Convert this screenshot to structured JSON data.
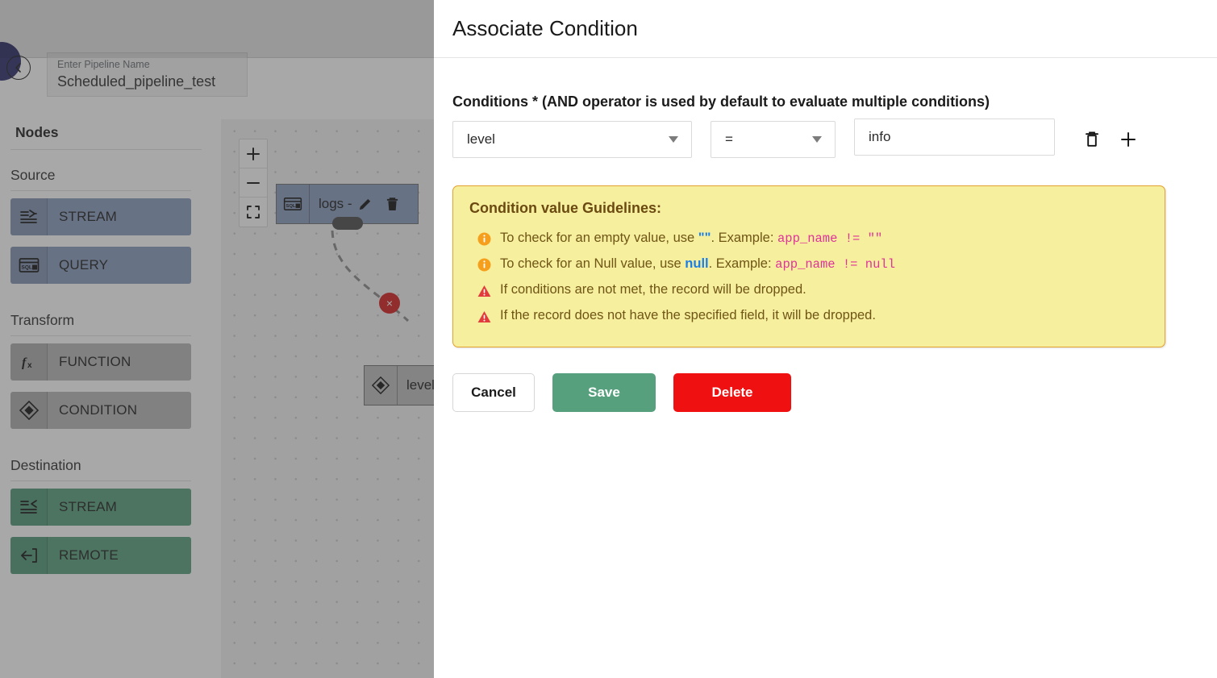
{
  "app": {
    "pipeline": {
      "name_label": "Enter Pipeline Name",
      "name_value": "Scheduled_pipeline_test"
    },
    "sidebar": {
      "title": "Nodes",
      "sections": [
        {
          "label": "Source",
          "items": [
            {
              "label": "STREAM",
              "icon": "stream-in-icon",
              "color": "blue"
            },
            {
              "label": "QUERY",
              "icon": "sql-query-icon",
              "color": "blue"
            }
          ]
        },
        {
          "label": "Transform",
          "items": [
            {
              "label": "FUNCTION",
              "icon": "fx-icon",
              "color": "gray"
            },
            {
              "label": "CONDITION",
              "icon": "diamond-icon",
              "color": "gray"
            }
          ]
        },
        {
          "label": "Destination",
          "items": [
            {
              "label": "STREAM",
              "icon": "stream-out-icon",
              "color": "green"
            },
            {
              "label": "REMOTE",
              "icon": "remote-icon",
              "color": "green"
            }
          ]
        }
      ]
    },
    "canvas": {
      "zoom_in": "+",
      "zoom_out": "−",
      "fit_view": "fit-view-icon",
      "nodes": [
        {
          "label": "logs -",
          "icon": "sql-query-icon",
          "type": "query"
        },
        {
          "label": "level",
          "icon": "diamond-icon",
          "type": "condition"
        }
      ],
      "edge_delete": "×"
    }
  },
  "modal": {
    "title": "Associate Condition",
    "conditions_label": "Conditions * (AND operator is used by default to evaluate multiple conditions)",
    "row": {
      "field_value": "level",
      "operator_value": "=",
      "value_value": "info",
      "value_placeholder": "",
      "delete_icon": "trash-icon",
      "add_icon": "plus-icon"
    },
    "guidelines": {
      "title": "Condition value Guidelines:",
      "items": [
        {
          "icon": "info-icon",
          "pre": "To check for an empty value, use ",
          "token": "\"\"",
          "mid": ". Example:  ",
          "code": "app_name != \"\""
        },
        {
          "icon": "info-icon",
          "pre": "To check for an Null value, use ",
          "token": "null",
          "mid": ". Example:  ",
          "code": "app_name != null"
        },
        {
          "icon": "warning-icon",
          "pre": "If conditions are not met, the record will be dropped.",
          "token": "",
          "mid": "",
          "code": ""
        },
        {
          "icon": "warning-icon",
          "pre": "If the record does not have the specified field, it will be dropped.",
          "token": "",
          "mid": "",
          "code": ""
        }
      ]
    },
    "buttons": {
      "cancel": "Cancel",
      "save": "Save",
      "delete": "Delete"
    }
  },
  "colors": {
    "save_green": "#56a07d",
    "delete_red": "#ef1111",
    "guideline_bg": "#f6ef9d",
    "guideline_border": "#e3a12f",
    "code_pink": "#e0339a",
    "token_blue": "#1a7fe8",
    "node_blue": "#8a9cbe",
    "brand_navy": "#2b2b6b"
  }
}
